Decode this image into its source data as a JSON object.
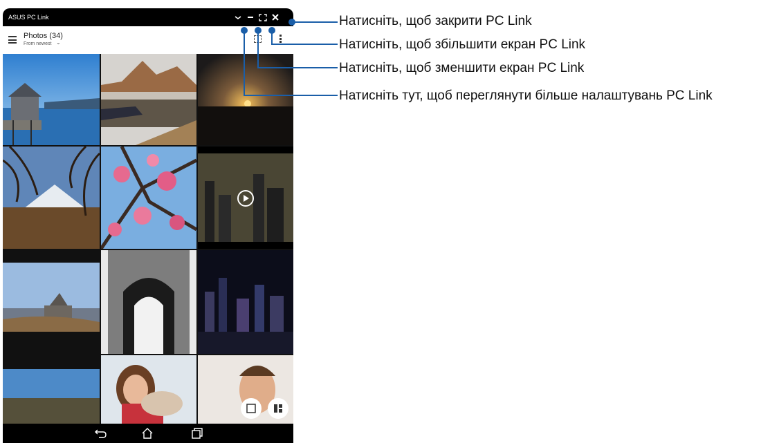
{
  "window": {
    "title": "ASUS PC Link"
  },
  "appbar": {
    "title": "Photos (34)",
    "sort": "From newest"
  },
  "callouts": {
    "close": "Натисніть, щоб закрити PC Link",
    "maximize": "Натисніть, щоб збільшити екран PC Link",
    "minimize": "Натисніть, щоб зменшити екран PC Link",
    "more": "Натисніть тут, щоб переглянути більше налаштувань PC Link"
  },
  "icons": [
    "chevron-down-icon",
    "minimize-icon",
    "maximize-icon",
    "close-icon",
    "menu-icon",
    "select-icon",
    "more-icon",
    "play-icon",
    "collage-icon",
    "grid-layout-icon",
    "back-icon",
    "home-icon",
    "recent-apps-icon"
  ],
  "colors": {
    "callout_line": "#1a5ea8",
    "titlebar": "#000000"
  }
}
